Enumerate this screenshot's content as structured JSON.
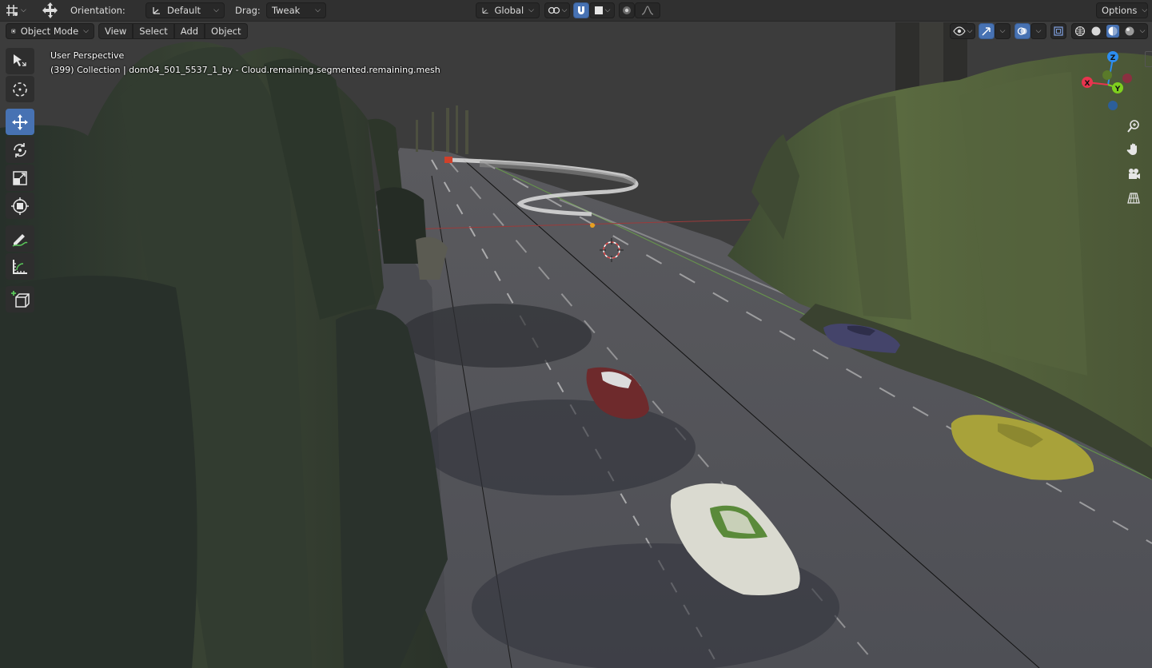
{
  "header": {
    "orientation_label": "Orientation:",
    "orientation_value": "Default",
    "drag_label": "Drag:",
    "drag_value": "Tweak",
    "transform_orientation": "Global",
    "options_label": "Options"
  },
  "mode_bar": {
    "mode": "Object Mode",
    "menus": [
      "View",
      "Select",
      "Add",
      "Object"
    ]
  },
  "viewport": {
    "view_name": "User Perspective",
    "collection_info": "(399) Collection | dom04_501_5537_1_by - Cloud.remaining.segmented.remaining.mesh"
  },
  "gizmo": {
    "x_label": "X",
    "y_label": "Y",
    "z_label": "Z"
  },
  "toolbar": {
    "tools": [
      "select-box-icon",
      "cursor-icon",
      "move-icon",
      "rotate-icon",
      "scale-icon",
      "transform-icon",
      "annotate-icon",
      "measure-icon",
      "add-cube-icon"
    ],
    "active_tool": "move-icon"
  },
  "colors": {
    "accent": "#4772b3",
    "axis_x": "#e8344e",
    "axis_y": "#7fd01e",
    "axis_z": "#2c8df1"
  }
}
